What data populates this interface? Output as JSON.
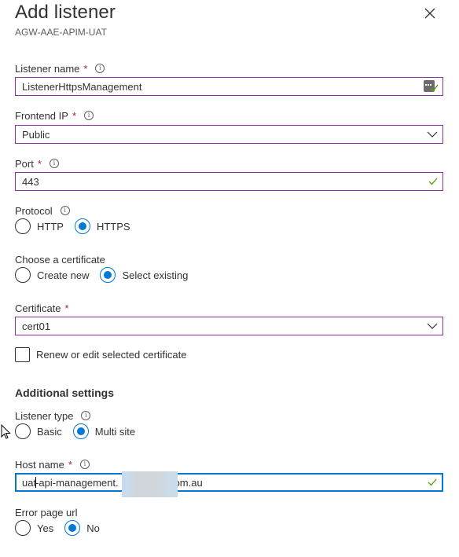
{
  "header": {
    "title": "Add listener",
    "subtitle": "AGW-AAE-APIM-UAT",
    "close_icon": "close-icon"
  },
  "form": {
    "listener_name": {
      "label": "Listener name",
      "required": "*",
      "value": "ListenerHttpsManagement",
      "status_icon": "valid-check-icon"
    },
    "frontend_ip": {
      "label": "Frontend IP",
      "required": "*",
      "value": "Public"
    },
    "port": {
      "label": "Port",
      "required": "*",
      "value": "443",
      "status_icon": "valid-check-icon"
    },
    "protocol": {
      "label": "Protocol",
      "options": [
        {
          "label": "HTTP",
          "selected": false
        },
        {
          "label": "HTTPS",
          "selected": true
        }
      ]
    },
    "certificate_choice": {
      "label": "Choose a certificate",
      "options": [
        {
          "label": "Create new",
          "selected": false
        },
        {
          "label": "Select existing",
          "selected": true
        }
      ]
    },
    "certificate": {
      "label": "Certificate",
      "required": "*",
      "value": "cert01"
    },
    "renew_checkbox": {
      "label": "Renew or edit selected certificate",
      "checked": false
    },
    "additional_settings": {
      "heading": "Additional settings"
    },
    "listener_type": {
      "label": "Listener type",
      "options": [
        {
          "label": "Basic",
          "selected": false
        },
        {
          "label": "Multi site",
          "selected": true
        }
      ]
    },
    "host_name": {
      "label": "Host name",
      "required": "*",
      "value_prefix": "uat",
      "value_rest": "-api-management.",
      "value_suffix": "om.au",
      "status_icon": "valid-check-icon"
    },
    "error_page_url": {
      "label": "Error page url",
      "options": [
        {
          "label": "Yes",
          "selected": false
        },
        {
          "label": "No",
          "selected": true
        }
      ]
    }
  },
  "colors": {
    "accent": "#0078d4",
    "field_border": "#8a2da5",
    "required": "#a4262c",
    "valid": "#57a300"
  }
}
